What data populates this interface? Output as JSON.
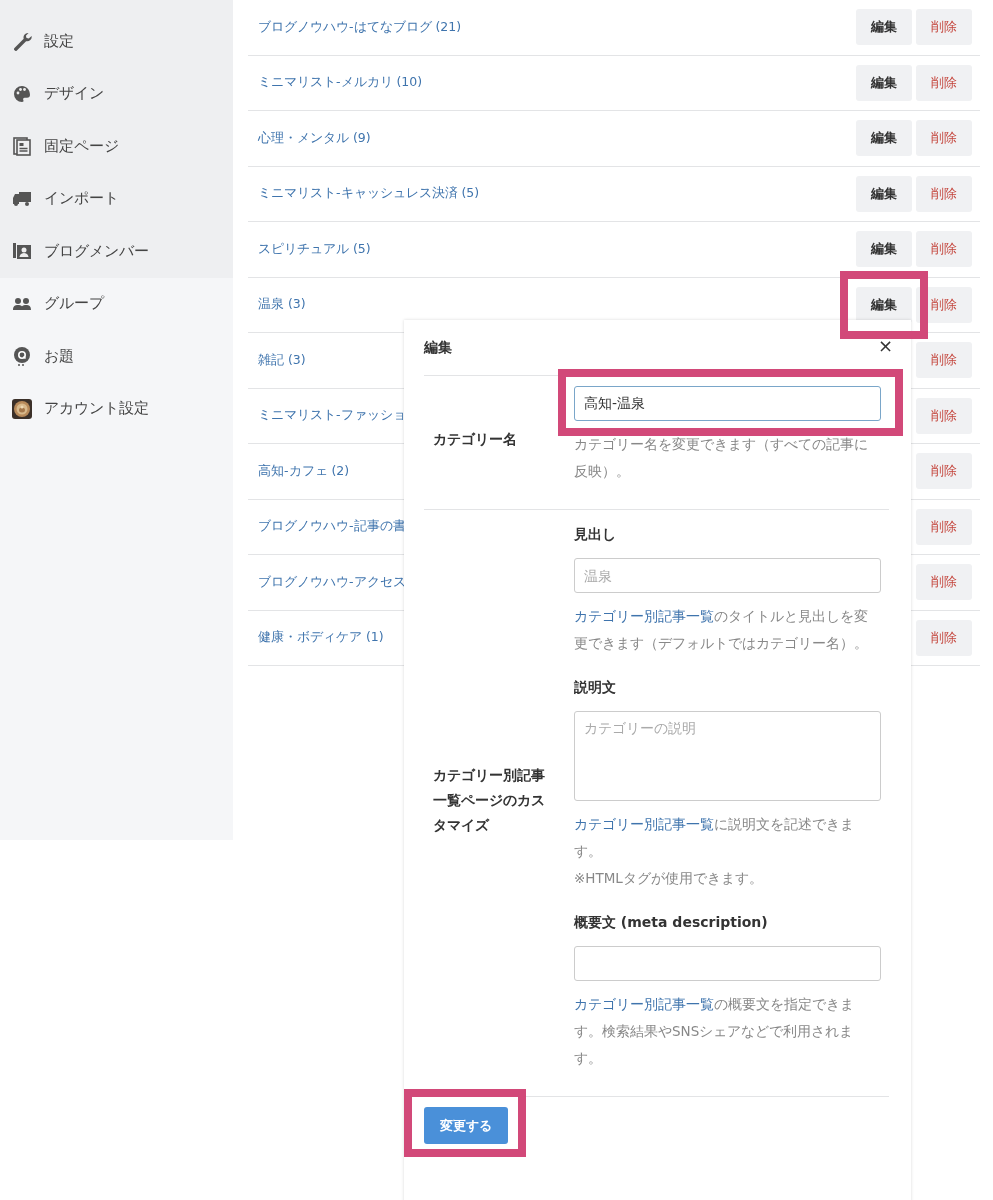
{
  "sidebar": {
    "sections": [
      {
        "shaded": true,
        "items": [
          {
            "label": "設定"
          },
          {
            "label": "デザイン"
          },
          {
            "label": "固定ページ"
          },
          {
            "label": "インポート"
          },
          {
            "label": "ブログメンバー"
          }
        ]
      },
      {
        "shaded": false,
        "items": [
          {
            "label": "グループ"
          },
          {
            "label": "お題"
          },
          {
            "label": "アカウント設定"
          }
        ]
      }
    ]
  },
  "categories": [
    {
      "name": "ブログノウハウ-はてなブログ (21)",
      "edit": "編集",
      "delete": "削除",
      "highlighted": false
    },
    {
      "name": "ミニマリスト-メルカリ (10)",
      "edit": "編集",
      "delete": "削除",
      "highlighted": false
    },
    {
      "name": "心理・メンタル (9)",
      "edit": "編集",
      "delete": "削除",
      "highlighted": false
    },
    {
      "name": "ミニマリスト-キャッシュレス決済 (5)",
      "edit": "編集",
      "delete": "削除",
      "highlighted": false
    },
    {
      "name": "スピリチュアル (5)",
      "edit": "編集",
      "delete": "削除",
      "highlighted": false
    },
    {
      "name": "温泉 (3)",
      "edit": "編集",
      "delete": "削除",
      "highlighted": true
    },
    {
      "name": "雑記 (3)",
      "delete": "削除",
      "highlighted": false
    },
    {
      "name": "ミニマリスト-ファッショ",
      "delete": "削除",
      "highlighted": false
    },
    {
      "name": "高知-カフェ (2)",
      "delete": "削除",
      "highlighted": false
    },
    {
      "name": "ブログノウハウ-記事の書",
      "delete": "削除",
      "highlighted": false
    },
    {
      "name": "ブログノウハウ-アクセス",
      "delete": "削除",
      "highlighted": false
    },
    {
      "name": "健康・ボディケア (1)",
      "delete": "削除",
      "highlighted": false
    }
  ],
  "dialog": {
    "title": "編集",
    "close": "×",
    "sections": [
      {
        "label": "カテゴリー名",
        "fields": [
          {
            "kind": "input",
            "value": "高知-温泉",
            "highlighted": true,
            "help": [
              {
                "parts": [
                  {
                    "kind": "text",
                    "text": "カテゴリー名を変更できます（すべての記事に反映）。"
                  }
                ]
              }
            ]
          }
        ]
      },
      {
        "label": "カテゴリー別記事一覧ページのカスタマイズ",
        "fields": [
          {
            "kind": "input",
            "heading": "見出し",
            "placeholder": "温泉",
            "highlighted": false,
            "help": [
              {
                "parts": [
                  {
                    "kind": "link",
                    "text": "カテゴリー別記事一覧"
                  },
                  {
                    "kind": "text",
                    "text": "のタイトルと見出しを変更できます（デフォルトではカテゴリー名）。"
                  }
                ]
              }
            ]
          },
          {
            "kind": "textarea",
            "heading": "説明文",
            "placeholder": "カテゴリーの説明",
            "highlighted": false,
            "help": [
              {
                "parts": [
                  {
                    "kind": "link",
                    "text": "カテゴリー別記事一覧"
                  },
                  {
                    "kind": "text",
                    "text": "に説明文を記述できます。"
                  }
                ]
              },
              {
                "parts": [
                  {
                    "kind": "text",
                    "text": "※HTMLタグが使用できます。"
                  }
                ]
              }
            ]
          },
          {
            "kind": "input",
            "heading": "概要文 (meta description)",
            "highlighted": false,
            "help": [
              {
                "parts": [
                  {
                    "kind": "link",
                    "text": "カテゴリー別記事一覧"
                  },
                  {
                    "kind": "text",
                    "text": "の概要文を指定できます。検索結果やSNSシェアなどで利用されます。"
                  }
                ]
              }
            ]
          }
        ]
      }
    ],
    "submit": {
      "label": "変更する",
      "highlighted": true
    }
  }
}
